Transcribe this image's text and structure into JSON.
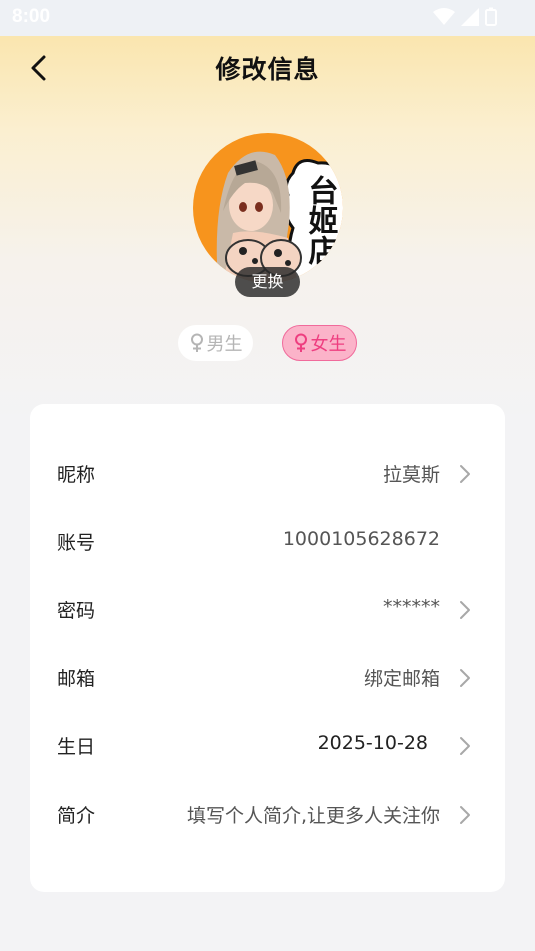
{
  "status_bar": {
    "time": "8:00"
  },
  "header": {
    "title": "修改信息"
  },
  "avatar": {
    "change_label": "更换",
    "image_text": "台姬店"
  },
  "gender": {
    "male_label": "男生",
    "female_label": "女生",
    "selected": "female",
    "male_color": "#b5b5b5",
    "female_color": "#ee3e80"
  },
  "info": {
    "rows": [
      {
        "label": "昵称",
        "value": "拉莫斯",
        "has_arrow": true
      },
      {
        "label": "账号",
        "value": "1000105628672",
        "has_arrow": false
      },
      {
        "label": "密码",
        "value": "******",
        "has_arrow": true
      },
      {
        "label": "邮箱",
        "value": "绑定邮箱",
        "has_arrow": true
      },
      {
        "label": "生日",
        "value": "2025-10-28",
        "has_arrow": true
      },
      {
        "label": "简介",
        "value": "填写个人简介,让更多人关注你",
        "has_arrow": true
      }
    ]
  }
}
